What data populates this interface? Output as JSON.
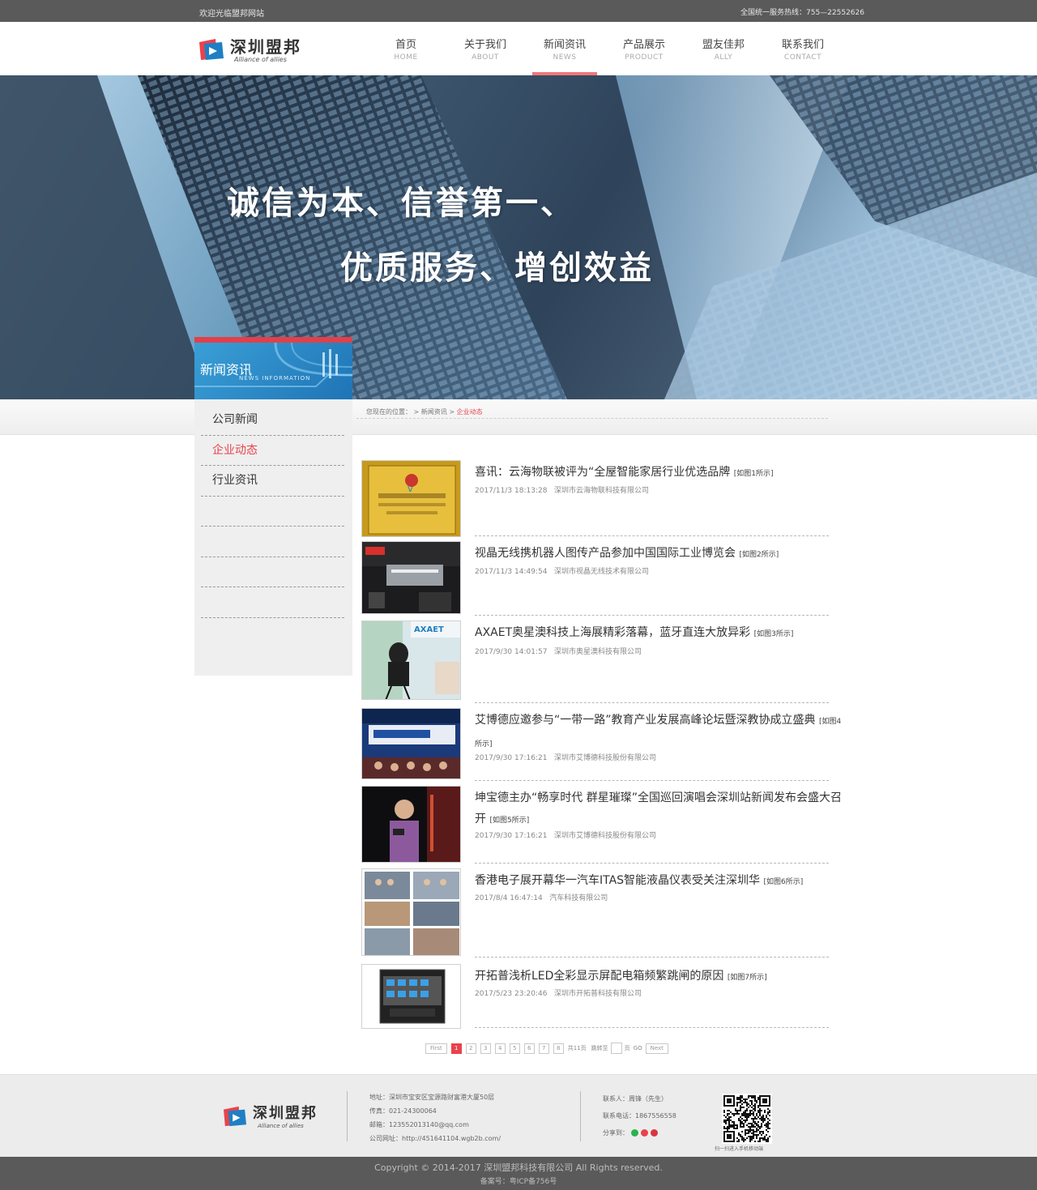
{
  "topbar": {
    "welcome": "欢迎光临盟邦网站",
    "hotline": "全国统一服务热线：755—22552626"
  },
  "brand": {
    "name": "深圳盟邦",
    "slogan_en": "Alliance of allies",
    "colors": {
      "red": "#e8434c",
      "blue": "#1f7fc4",
      "nav_active": "#f2777a"
    }
  },
  "nav": [
    {
      "cn": "首页",
      "en": "HOME"
    },
    {
      "cn": "关于我们",
      "en": "ABOUT"
    },
    {
      "cn": "新闻资讯",
      "en": "NEWS",
      "active": true
    },
    {
      "cn": "产品展示",
      "en": "PRODUCT"
    },
    {
      "cn": "盟友佳邦",
      "en": "ALLY"
    },
    {
      "cn": "联系我们",
      "en": "CONTACT"
    }
  ],
  "banner": {
    "line1": "诚信为本、信誉第一、",
    "line2": "优质服务、增创效益"
  },
  "sidebar": {
    "title": "新闻资讯",
    "subtitle": "NEWS INFORMATION",
    "items": [
      "公司新闻",
      "企业动态",
      "行业资讯",
      "",
      "",
      "",
      ""
    ],
    "active_index": 1
  },
  "breadcrumb": {
    "prefix": "您现在的位置：",
    "sep1": "> ",
    "level1": "新闻资讯",
    "sep2": ">",
    "current": "企业动态"
  },
  "news": [
    {
      "title": "喜讯：云海物联被评为“全屋智能家居行业优选品牌",
      "tag": "[如图1所示]",
      "date": "2017/11/3 18:13:28",
      "company": "深圳市云海物联科技有限公司",
      "thumb_icon": "award-certificate-image"
    },
    {
      "title": "视晶无线携机器人图传产品参加中国国际工业博览会",
      "tag": "[如图2所示]",
      "date": "2017/11/3 14:49:54",
      "company": "深圳市视晶无线技术有限公司",
      "thumb_icon": "expo-booth-image"
    },
    {
      "title": "AXAET奥星澳科技上海展精彩落幕，蓝牙直连大放异彩",
      "tag": "[如图3所示]",
      "date": "2017/9/30 14:01:57",
      "company": "深圳市奥星澳科技有限公司",
      "thumb_icon": "exhibition-camera-image"
    },
    {
      "title": "艾博德应邀参与“一带一路”教育产业发展高峰论坛暨深教协成立盛典",
      "tag": "[如图4所示]",
      "date": "2017/9/30 17:16:21",
      "company": "深圳市艾博德科技股份有限公司",
      "thumb_icon": "conference-stage-image"
    },
    {
      "title": "坤宝德主办“畅享时代 群星璀璨”全国巡回演唱会深圳站新闻发布会盛大召开",
      "tag": "[如图5所示]",
      "date": "2017/9/30 17:16:21",
      "company": "深圳市艾博德科技股份有限公司",
      "thumb_icon": "press-conference-image"
    },
    {
      "title": "香港电子展开幕华一汽车ITAS智能液晶仪表受关注深圳华",
      "tag": "[如图6所示]",
      "date": "2017/8/4 16:47:14",
      "company": "汽车科技有限公司",
      "thumb_icon": "group-photo-collage-image"
    },
    {
      "title": "开拓普浅析LED全彩显示屏配电箱频繁跳闸的原因",
      "tag": "[如图7所示]",
      "date": "2017/5/23 23:20:46",
      "company": "深圳市开拓普科技有限公司",
      "thumb_icon": "power-cabinet-image"
    }
  ],
  "pager": {
    "first": "First",
    "pages": [
      "1",
      "2",
      "3",
      "4",
      "5",
      "6",
      "7",
      "8"
    ],
    "active_page": "1",
    "total": "共11页",
    "goto_label": "跳转至",
    "goto_unit": "页",
    "go": "GO",
    "next": "Next"
  },
  "footer": {
    "address": "地址：深圳市宝安区宝源路财富港大厦50层",
    "fax": "传真：021-24300064",
    "email": "邮箱：123552013140@qq.com",
    "website": "公司网址：http://451641104.wgb2b.com/",
    "contact": "联系人：周锋（先生）",
    "phone": "联系电话：1867556558",
    "share": "分享到：",
    "qr_caption": "扫一扫进入手机移动端",
    "copyright": "Copyright © 2014-2017   深圳盟邦科技有限公司   All Rights reserved.",
    "icp": "备案号：粤ICP备756号"
  }
}
